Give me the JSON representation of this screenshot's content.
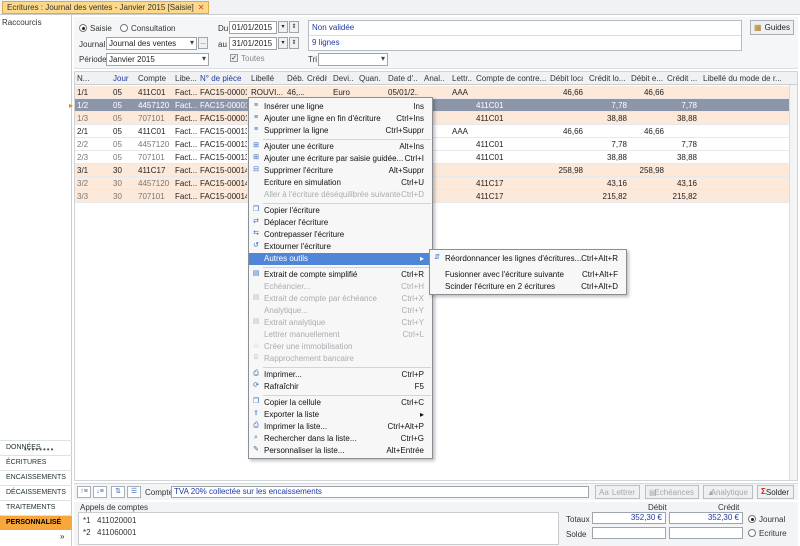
{
  "tab": {
    "title": "Ecritures : Journal des ventes - Janvier 2015 [Saisie]"
  },
  "sidebar": {
    "title": "Raccourcis",
    "dots": "••••••••",
    "items": [
      "DONNÉES",
      "ÉCRITURES",
      "ENCAISSEMENTS",
      "DÉCAISSEMENTS",
      "TRAITEMENTS",
      "PERSONNALISÉ"
    ],
    "active": "PERSONNALISÉ"
  },
  "form": {
    "mode_saisie": "Saisie",
    "mode_consultation": "Consultation",
    "journal_label": "Journal",
    "journal_value": "Journal des ventes",
    "periode_label": "Période",
    "periode_value": "Janvier 2015",
    "du_label": "Du",
    "du_value": "01/01/2015",
    "au_label": "au",
    "au_value": "31/01/2015",
    "toutes_label": "Toutes",
    "tri_label": "Tri",
    "tri_value": "",
    "status": "Non validée",
    "lines": "9 lignes",
    "guides": "Guides"
  },
  "grid": {
    "headers": [
      "N...",
      "Jour",
      "Compte",
      "Libe...",
      "N° de pièce",
      "Libellé",
      "Déb...",
      "Crédit",
      "Devi...",
      "Quan...",
      "Date d'...",
      "Anal...",
      "Lettr...",
      "Compte de contre...",
      "Débit local",
      "Crédit lo...",
      "Débit e...",
      "Crédit ...",
      "Libellé du mode de r..."
    ],
    "rows": [
      [
        "1/1",
        "05",
        "411C01",
        "Fact...",
        "FAC15-00001",
        "ROUVI...",
        "46,...",
        "",
        "Euro",
        "",
        "05/01/2...",
        "",
        "AAA",
        "",
        "46,66",
        "",
        "46,66",
        "",
        ""
      ],
      [
        "1/2",
        "05",
        "4457120",
        "Fact...",
        "FAC15-00001",
        "",
        "",
        "",
        "",
        "",
        "",
        "",
        "",
        "411C01",
        "",
        "7,78",
        "",
        "7,78",
        ""
      ],
      [
        "1/3",
        "05",
        "707101",
        "Fact...",
        "FAC15-00001",
        "",
        "",
        "",
        "",
        "",
        "",
        "",
        "",
        "411C01",
        "",
        "38,88",
        "",
        "38,88",
        ""
      ],
      [
        "2/1",
        "05",
        "411C01",
        "Fact...",
        "FAC15-00013",
        "",
        "",
        "",
        "",
        "",
        "",
        "",
        "AAA",
        "",
        "46,66",
        "",
        "46,66",
        "",
        ""
      ],
      [
        "2/2",
        "05",
        "4457120",
        "Fact...",
        "FAC15-00013",
        "",
        "",
        "",
        "",
        "",
        "",
        "",
        "",
        "411C01",
        "",
        "7,78",
        "",
        "7,78",
        ""
      ],
      [
        "2/3",
        "05",
        "707101",
        "Fact...",
        "FAC15-00013",
        "",
        "",
        "",
        "",
        "",
        "",
        "",
        "",
        "411C01",
        "",
        "38,88",
        "",
        "38,88",
        ""
      ],
      [
        "3/1",
        "30",
        "411C17",
        "Fact...",
        "FAC15-00014",
        "",
        "",
        "",
        "",
        "",
        "",
        "",
        "",
        "",
        "258,98",
        "",
        "258,98",
        "",
        ""
      ],
      [
        "3/2",
        "30",
        "4457120",
        "Fact...",
        "FAC15-00014",
        "",
        "",
        "",
        "",
        "",
        "",
        "",
        "",
        "411C17",
        "",
        "43,16",
        "",
        "43,16",
        ""
      ],
      [
        "3/3",
        "30",
        "707101",
        "Fact...",
        "FAC15-00014",
        "",
        "",
        "",
        "",
        "",
        "",
        "",
        "",
        "411C17",
        "",
        "215,82",
        "",
        "215,82",
        ""
      ]
    ]
  },
  "context_menu": [
    {
      "label": "Insérer une ligne",
      "shortcut": "Ins",
      "icon": "insert-row-icon",
      "disabled": false
    },
    {
      "label": "Ajouter une ligne en fin d'écriture",
      "shortcut": "Ctrl+Ins",
      "icon": "add-row-icon",
      "disabled": false
    },
    {
      "label": "Supprimer la ligne",
      "shortcut": "Ctrl+Suppr",
      "icon": "delete-row-icon",
      "disabled": false
    },
    {
      "sep": true
    },
    {
      "label": "Ajouter une écriture",
      "shortcut": "Alt+Ins",
      "icon": "add-entry-icon",
      "disabled": false
    },
    {
      "label": "Ajouter une écriture par saisie guidée...",
      "shortcut": "Ctrl+I",
      "icon": "guided-entry-icon",
      "disabled": false
    },
    {
      "label": "Supprimer l'écriture",
      "shortcut": "Alt+Suppr",
      "icon": "delete-entry-icon",
      "disabled": false
    },
    {
      "label": "Ecriture en simulation",
      "shortcut": "Ctrl+U",
      "icon": "",
      "disabled": false
    },
    {
      "label": "Aller à l'écriture déséquilibrée suivante",
      "shortcut": "Ctrl+D",
      "icon": "",
      "disabled": true
    },
    {
      "sep": true
    },
    {
      "label": "Copier l'écriture",
      "shortcut": "",
      "icon": "copy-entry-icon",
      "disabled": false
    },
    {
      "label": "Déplacer l'écriture",
      "shortcut": "",
      "icon": "move-entry-icon",
      "disabled": false
    },
    {
      "label": "Contrepasser l'écriture",
      "shortcut": "",
      "icon": "reverse-entry-icon",
      "disabled": false
    },
    {
      "label": "Extourner l'écriture",
      "shortcut": "",
      "icon": "extourne-icon",
      "disabled": false
    },
    {
      "label": "Autres outils",
      "shortcut": "",
      "icon": "",
      "disabled": false,
      "highlight": true,
      "submenu": true
    },
    {
      "sep": true
    },
    {
      "label": "Extrait de compte simplifié",
      "shortcut": "Ctrl+R",
      "icon": "account-extract-icon",
      "disabled": false
    },
    {
      "label": "Echéancier...",
      "shortcut": "Ctrl+H",
      "icon": "",
      "disabled": true
    },
    {
      "label": "Extrait de compte par échéance",
      "shortcut": "Ctrl+X",
      "icon": "extract-deadline-icon",
      "disabled": true
    },
    {
      "label": "Analytique...",
      "shortcut": "Ctrl+Y",
      "icon": "",
      "disabled": true
    },
    {
      "label": "Extrait analytique",
      "shortcut": "Ctrl+Y",
      "icon": "analytic-extract-icon",
      "disabled": true
    },
    {
      "label": "Lettrer manuellement",
      "shortcut": "Ctrl+L",
      "icon": "",
      "disabled": true
    },
    {
      "label": "Créer une immobilisation",
      "shortcut": "",
      "icon": "asset-icon",
      "disabled": true
    },
    {
      "label": "Rapprochement bancaire",
      "shortcut": "",
      "icon": "bank-icon",
      "disabled": true
    },
    {
      "sep": true
    },
    {
      "label": "Imprimer...",
      "shortcut": "Ctrl+P",
      "icon": "print-icon",
      "disabled": false
    },
    {
      "label": "Rafraîchir",
      "shortcut": "F5",
      "icon": "refresh-icon",
      "disabled": false
    },
    {
      "sep": true
    },
    {
      "label": "Copier la cellule",
      "shortcut": "Ctrl+C",
      "icon": "copy-cell-icon",
      "disabled": false
    },
    {
      "label": "Exporter la liste",
      "shortcut": "▸",
      "icon": "export-icon",
      "disabled": false
    },
    {
      "label": "Imprimer la liste...",
      "shortcut": "Ctrl+Alt+P",
      "icon": "print-list-icon",
      "disabled": false
    },
    {
      "label": "Rechercher dans la liste...",
      "shortcut": "Ctrl+G",
      "icon": "search-list-icon",
      "disabled": false
    },
    {
      "label": "Personnaliser la liste...",
      "shortcut": "Alt+Entrée",
      "icon": "customize-list-icon",
      "disabled": false
    }
  ],
  "submenu": [
    {
      "label": "Réordonnancer les lignes d'écritures...",
      "shortcut": "Ctrl+Alt+R",
      "icon": "reorder-icon"
    },
    {
      "label": "Fusionner avec l'écriture suivante",
      "shortcut": "Ctrl+Alt+F",
      "icon": ""
    },
    {
      "label": "Scinder l'écriture en 2 écritures",
      "shortcut": "Ctrl+Alt+D",
      "icon": ""
    }
  ],
  "toolbar": {
    "compte_label": "Compte",
    "compte_value": "TVA 20% collectée sur les encaissements",
    "lettrer": "Lettrer",
    "echeances": "Echéances",
    "analytique": "Analytique",
    "solder": "Solder"
  },
  "bottom": {
    "appels_title": "Appels de comptes",
    "appels": [
      {
        "key": "*1",
        "value": "411020001"
      },
      {
        "key": "*2",
        "value": "411060001"
      }
    ],
    "debit_label": "Débit",
    "credit_label": "Crédit",
    "totaux_label": "Totaux",
    "solde_label": "Solde",
    "totaux_debit": "352,30 €",
    "totaux_credit": "352,30 €",
    "radio_journal": "Journal",
    "radio_ecriture": "Ecriture"
  },
  "colors": {
    "accent": "#f7a73c",
    "selected_row": "#8d96a8",
    "group_row": "#fde9d9",
    "highlight": "#4f86d8"
  }
}
